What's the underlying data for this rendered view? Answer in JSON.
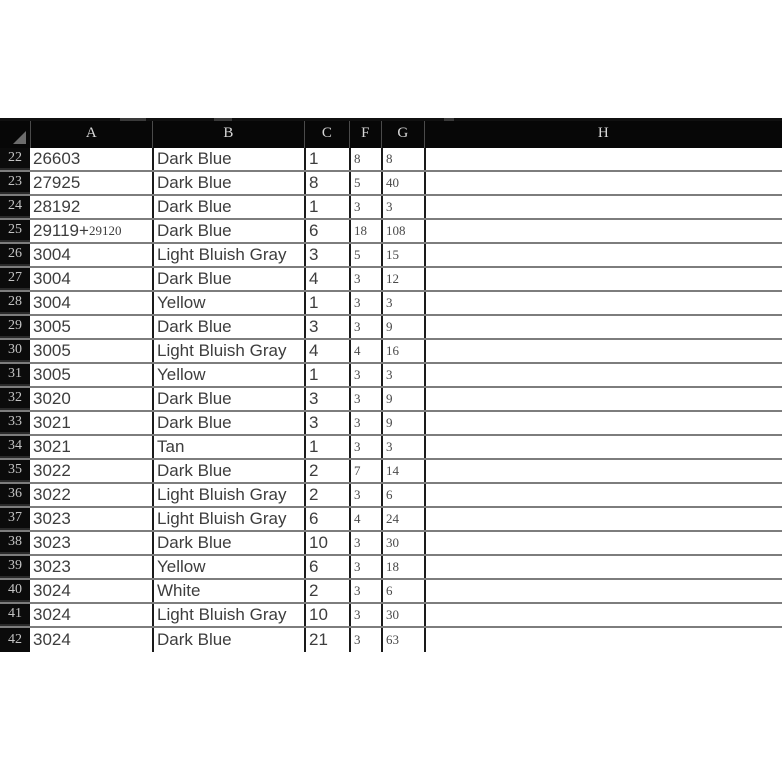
{
  "app": {
    "type": "spreadsheet",
    "colors": {
      "header_background": "#070707",
      "header_text": "#d8d8d8",
      "row_header_background": "#0b0b0b",
      "row_header_text": "#c4c4c4",
      "cell_background": "#ffffff",
      "cell_text": "#3d3d3d",
      "gridline": "#7d7d7d",
      "column_divider": "#1a1a1a"
    }
  },
  "grid": {
    "corner_label": "select-all",
    "columns": [
      {
        "id": "A",
        "label": "A"
      },
      {
        "id": "B",
        "label": "B"
      },
      {
        "id": "C",
        "label": "C"
      },
      {
        "id": "F",
        "label": "F"
      },
      {
        "id": "G",
        "label": "G"
      },
      {
        "id": "H",
        "label": "H"
      }
    ],
    "row_numbers": [
      "22",
      "23",
      "24",
      "25",
      "26",
      "27",
      "28",
      "29",
      "30",
      "31",
      "32",
      "33",
      "34",
      "35",
      "36",
      "37",
      "38",
      "39",
      "40",
      "41",
      "42"
    ],
    "rows": [
      {
        "n": "22",
        "A": "26603",
        "A_small": "",
        "B": "Dark Blue",
        "C": "1",
        "F": "8",
        "G": "8",
        "H": ""
      },
      {
        "n": "23",
        "A": "27925",
        "A_small": "",
        "B": "Dark Blue",
        "C": "8",
        "F": "5",
        "G": "40",
        "H": ""
      },
      {
        "n": "24",
        "A": "28192",
        "A_small": "",
        "B": "Dark Blue",
        "C": "1",
        "F": "3",
        "G": "3",
        "H": ""
      },
      {
        "n": "25",
        "A": "29119+",
        "A_small": "29120",
        "B": "Dark Blue",
        "C": "6",
        "F": "18",
        "G": "108",
        "H": ""
      },
      {
        "n": "26",
        "A": "3004",
        "A_small": "",
        "B": "Light Bluish Gray",
        "C": "3",
        "F": "5",
        "G": "15",
        "H": ""
      },
      {
        "n": "27",
        "A": "3004",
        "A_small": "",
        "B": "Dark Blue",
        "C": "4",
        "F": "3",
        "G": "12",
        "H": ""
      },
      {
        "n": "28",
        "A": "3004",
        "A_small": "",
        "B": "Yellow",
        "C": "1",
        "F": "3",
        "G": "3",
        "H": ""
      },
      {
        "n": "29",
        "A": "3005",
        "A_small": "",
        "B": "Dark Blue",
        "C": "3",
        "F": "3",
        "G": "9",
        "H": ""
      },
      {
        "n": "30",
        "A": "3005",
        "A_small": "",
        "B": "Light Bluish Gray",
        "C": "4",
        "F": "4",
        "G": "16",
        "H": ""
      },
      {
        "n": "31",
        "A": "3005",
        "A_small": "",
        "B": "Yellow",
        "C": "1",
        "F": "3",
        "G": "3",
        "H": ""
      },
      {
        "n": "32",
        "A": "3020",
        "A_small": "",
        "B": "Dark Blue",
        "C": "3",
        "F": "3",
        "G": "9",
        "H": ""
      },
      {
        "n": "33",
        "A": "3021",
        "A_small": "",
        "B": "Dark Blue",
        "C": "3",
        "F": "3",
        "G": "9",
        "H": ""
      },
      {
        "n": "34",
        "A": "3021",
        "A_small": "",
        "B": "Tan",
        "C": "1",
        "F": "3",
        "G": "3",
        "H": ""
      },
      {
        "n": "35",
        "A": "3022",
        "A_small": "",
        "B": "Dark Blue",
        "C": "2",
        "F": "7",
        "G": "14",
        "H": ""
      },
      {
        "n": "36",
        "A": "3022",
        "A_small": "",
        "B": "Light Bluish Gray",
        "C": "2",
        "F": "3",
        "G": "6",
        "H": ""
      },
      {
        "n": "37",
        "A": "3023",
        "A_small": "",
        "B": "Light Bluish Gray",
        "C": "6",
        "F": "4",
        "G": "24",
        "H": ""
      },
      {
        "n": "38",
        "A": "3023",
        "A_small": "",
        "B": "Dark Blue",
        "C": "10",
        "F": "3",
        "G": "30",
        "H": ""
      },
      {
        "n": "39",
        "A": "3023",
        "A_small": "",
        "B": "Yellow",
        "C": "6",
        "F": "3",
        "G": "18",
        "H": ""
      },
      {
        "n": "40",
        "A": "3024",
        "A_small": "",
        "B": "White",
        "C": "2",
        "F": "3",
        "G": "6",
        "H": ""
      },
      {
        "n": "41",
        "A": "3024",
        "A_small": "",
        "B": "Light Bluish Gray",
        "C": "10",
        "F": "3",
        "G": "30",
        "H": ""
      },
      {
        "n": "42",
        "A": "3024",
        "A_small": "",
        "B": "Dark Blue",
        "C": "21",
        "F": "3",
        "G": "63",
        "H": ""
      }
    ]
  }
}
